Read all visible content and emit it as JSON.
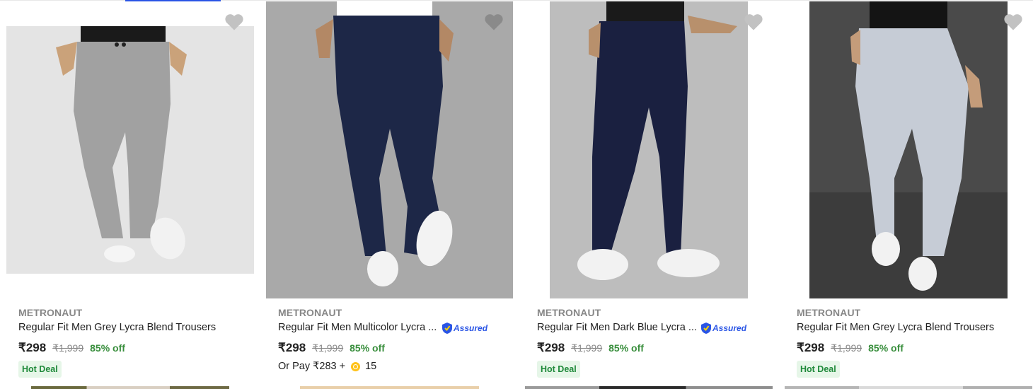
{
  "products": [
    {
      "brand": "METRONAUT",
      "title": "Regular Fit Men Grey Lycra Blend Trousers",
      "price": "₹298",
      "mrp": "₹1,999",
      "discount": "85% off",
      "badge": "Hot Deal",
      "pant_color": "#a1a1a1",
      "bg_color": "#e4e4e4"
    },
    {
      "brand": "METRONAUT",
      "title": "Regular Fit Men Multicolor Lycra ...",
      "assured": "Assured",
      "price": "₹298",
      "mrp": "₹1,999",
      "discount": "85% off",
      "pay_prefix": "Or Pay ₹283 +",
      "coins": "15",
      "pant_color": "#1d2747",
      "bg_color": "#a9a9a9"
    },
    {
      "brand": "METRONAUT",
      "title": "Regular Fit Men Dark Blue Lycra ...",
      "assured": "Assured",
      "price": "₹298",
      "mrp": "₹1,999",
      "discount": "85% off",
      "badge": "Hot Deal",
      "pant_color": "#1a2040",
      "bg_color": "#bdbdbd"
    },
    {
      "brand": "METRONAUT",
      "title": "Regular Fit Men Grey Lycra Blend Trousers",
      "price": "₹298",
      "mrp": "₹1,999",
      "discount": "85% off",
      "badge": "Hot Deal",
      "pant_color": "#c6ccd6",
      "bg_color": "#4a4a4a"
    }
  ],
  "colors": {
    "accent": "#2a55e5",
    "discount": "#388e3c",
    "badge_bg": "#e6f6e8",
    "wishlist": "#c2c2c2"
  }
}
